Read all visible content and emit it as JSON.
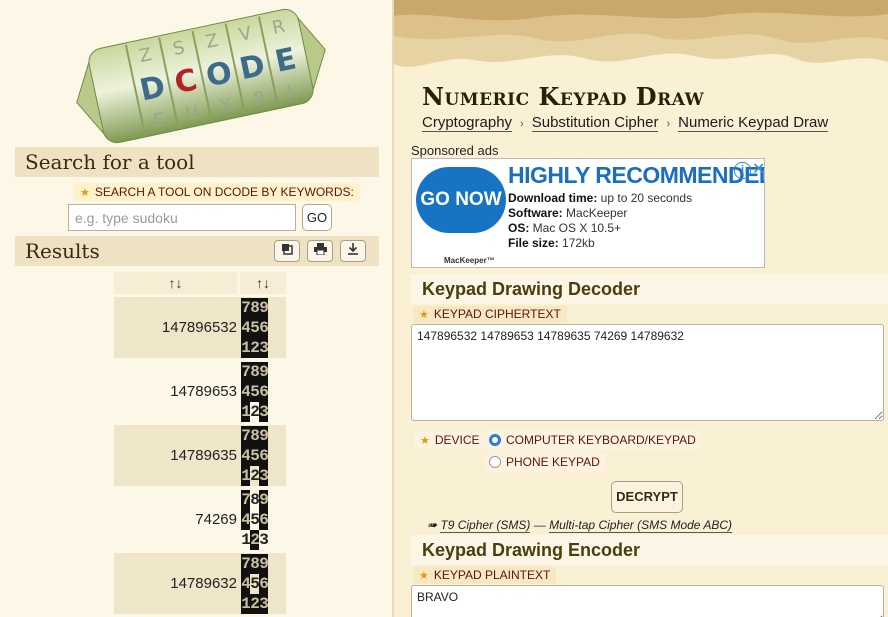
{
  "logo": {
    "brand": "DCODE"
  },
  "search": {
    "title": "Search for a tool",
    "label": "SEARCH A TOOL ON DCODE BY KEYWORDS:",
    "placeholder": "e.g. type sudoku",
    "go_label": "GO"
  },
  "results": {
    "title": "Results",
    "buttons": [
      "copy-icon",
      "print-icon",
      "download-icon"
    ],
    "headers": [
      "↑↓",
      "↑↓"
    ],
    "rows": [
      {
        "code": "147896532",
        "keypad": [
          [
            "7",
            "8",
            "9"
          ],
          [
            "4",
            "5",
            "6"
          ],
          [
            "1",
            "2",
            "3"
          ]
        ],
        "on": [
          [
            1,
            1,
            1
          ],
          [
            1,
            1,
            1
          ],
          [
            1,
            1,
            1
          ]
        ]
      },
      {
        "code": "14789653",
        "keypad": [
          [
            "7",
            "8",
            "9"
          ],
          [
            "4",
            "5",
            "6"
          ],
          [
            "1",
            "2",
            "3"
          ]
        ],
        "on": [
          [
            1,
            1,
            1
          ],
          [
            1,
            1,
            1
          ],
          [
            1,
            0,
            1
          ]
        ]
      },
      {
        "code": "14789635",
        "keypad": [
          [
            "7",
            "8",
            "9"
          ],
          [
            "4",
            "5",
            "6"
          ],
          [
            "1",
            "2",
            "3"
          ]
        ],
        "on": [
          [
            1,
            1,
            1
          ],
          [
            1,
            1,
            1
          ],
          [
            1,
            0,
            1
          ]
        ]
      },
      {
        "code": "74269",
        "keypad": [
          [
            "7",
            "8",
            "9"
          ],
          [
            "4",
            "5",
            "6"
          ],
          [
            "1",
            "2",
            "3"
          ]
        ],
        "on": [
          [
            1,
            0,
            1
          ],
          [
            1,
            0,
            1
          ],
          [
            0,
            1,
            0
          ]
        ]
      },
      {
        "code": "14789632",
        "keypad": [
          [
            "7",
            "8",
            "9"
          ],
          [
            "4",
            "5",
            "6"
          ],
          [
            "1",
            "2",
            "3"
          ]
        ],
        "on": [
          [
            1,
            1,
            1
          ],
          [
            1,
            0,
            1
          ],
          [
            1,
            1,
            1
          ]
        ]
      }
    ]
  },
  "page": {
    "title": "Numeric Keypad Draw",
    "breadcrumb": [
      "Cryptography",
      "Substitution Cipher",
      "Numeric Keypad Draw"
    ],
    "sponsored": "Sponsored ads"
  },
  "ad": {
    "button": "GO NOW",
    "headline": "HIGHLY RECOMMENDED",
    "lines": [
      {
        "k": "Download time:",
        "v": " up to 20 seconds"
      },
      {
        "k": "Software:",
        "v": " MacKeeper"
      },
      {
        "k": "OS:",
        "v": " Mac OS X 10.5+"
      },
      {
        "k": "File size:",
        "v": " 172kb"
      }
    ],
    "brand": "MacKeeper™"
  },
  "decoder": {
    "title": "Keypad Drawing Decoder",
    "cipher_label": "KEYPAD CIPHERTEXT",
    "cipher_value": "147896532 14789653 14789635 74269 14789632",
    "device_label": "DEVICE",
    "options": [
      "COMPUTER KEYBOARD/KEYPAD",
      "PHONE KEYPAD"
    ],
    "selected_option": "COMPUTER KEYBOARD/KEYPAD",
    "decrypt_label": "DECRYPT",
    "links": [
      "T9 Cipher (SMS)",
      "Multi-tap Cipher (SMS Mode ABC)"
    ],
    "links_prefix": "➠ ",
    "links_sep": " — "
  },
  "encoder": {
    "title": "Keypad Drawing Encoder",
    "plain_label": "KEYPAD PLAINTEXT",
    "plain_value": "BRAVO"
  },
  "colors": {
    "accent_blue": "#1774c4",
    "label_red": "#5c1414",
    "star": "#e09a18"
  }
}
